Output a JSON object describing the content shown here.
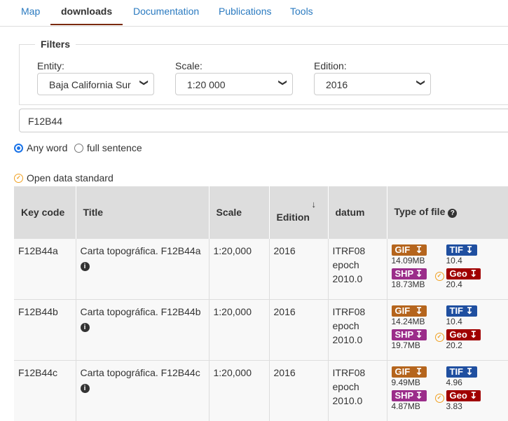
{
  "tabs": [
    {
      "label": "Map"
    },
    {
      "label": "downloads"
    },
    {
      "label": "Documentation"
    },
    {
      "label": "Publications"
    },
    {
      "label": "Tools"
    }
  ],
  "filters": {
    "legend": "Filters",
    "entity_label": "Entity:",
    "entity_value": "Baja California Sur",
    "scale_label": "Scale:",
    "scale_value": "1:20 000",
    "edition_label": "Edition:",
    "edition_value": "2016"
  },
  "search": {
    "value": "F12B44"
  },
  "radios": [
    {
      "label": "Any word",
      "checked": true
    },
    {
      "label": "full sentence",
      "checked": false
    }
  ],
  "open_data": "Open data standard",
  "colors": {
    "gif": "#b5651d",
    "shp": "#9b2d8a",
    "tif": "#1f4fa0",
    "geo": "#a00000",
    "accent": "#2a7ac0"
  },
  "table": {
    "headers": [
      "Key code",
      "Title",
      "Scale",
      "Edition",
      "datum",
      "Type of file"
    ],
    "rows": [
      {
        "key": "F12B44a",
        "title": "Carta topográfica. F12B44a",
        "scale": "1:20,000",
        "edition": "2016",
        "datum": [
          "ITRF08",
          "epoch",
          "2010.0"
        ],
        "gif": "14.09MB",
        "shp": "18.73MB",
        "tif": "10.4",
        "geo": "20.4"
      },
      {
        "key": "F12B44b",
        "title": "Carta topográfica. F12B44b",
        "scale": "1:20,000",
        "edition": "2016",
        "datum": [
          "ITRF08",
          "epoch",
          "2010.0"
        ],
        "gif": "14.24MB",
        "shp": "19.7MB",
        "tif": "10.4",
        "geo": "20.2"
      },
      {
        "key": "F12B44c",
        "title": "Carta topográfica. F12B44c",
        "scale": "1:20,000",
        "edition": "2016",
        "datum": [
          "ITRF08",
          "epoch",
          "2010.0"
        ],
        "gif": "9.49MB",
        "shp": "4.87MB",
        "tif": "4.96",
        "geo": "3.83"
      }
    ],
    "badges": {
      "gif": "GIF",
      "shp": "SHP",
      "tif": "TIF",
      "geo": "Geo"
    }
  }
}
